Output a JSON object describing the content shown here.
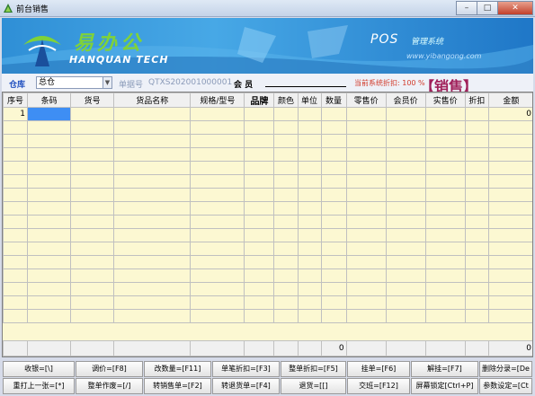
{
  "window": {
    "title": "前台销售",
    "buttons": {
      "minimize": "–",
      "maximize": "□",
      "close": "✕"
    }
  },
  "banner": {
    "logo_cn": "易办公",
    "logo_en": "HANQUAN TECH",
    "product": "POS",
    "product_sub": "管理系统",
    "website": "www.yibangong.com"
  },
  "toolbar": {
    "warehouse_label": "仓库",
    "warehouse_value": "总仓",
    "doc_label": "单据号",
    "doc_value": "QTXS202001000001",
    "member_label": "会  员",
    "discount_text": "当前系统折扣: 100 %",
    "mode": "【销售】"
  },
  "table": {
    "headers": [
      "序号",
      "条码",
      "货号",
      "货品名称",
      "规格/型号",
      "品牌",
      "颜色",
      "单位",
      "数量",
      "零售价",
      "会员价",
      "实售价",
      "折扣",
      "金额"
    ],
    "first_row": {
      "index": "1",
      "amount": "0"
    },
    "footer": {
      "quantity_total": "0",
      "amount_total": "0"
    }
  },
  "function_keys": {
    "row1": [
      "收银=[\\]",
      "调价=[F8]",
      "改数量=[F11]",
      "单笔折扣=[F3]",
      "整单折扣=[F5]",
      "挂单=[F6]",
      "解挂=[F7]",
      "删除分录=[De"
    ],
    "row2": [
      "重打上一张=[*]",
      "整单作废=[/]",
      "转销售单=[F2]",
      "转退货单=[F4]",
      "退货=[[]",
      "交班=[F12]",
      "屏幕锁定[Ctrl+P]",
      "参数设定=[Ct"
    ]
  },
  "colors": {
    "banner_blue": "#2f8fd6",
    "logo_green": "#7fd23a",
    "grid_bg": "#fcf8d2",
    "selected_cell": "#3e8ef4",
    "mode_color": "#a0205a",
    "discount_red": "#d23a2a"
  }
}
